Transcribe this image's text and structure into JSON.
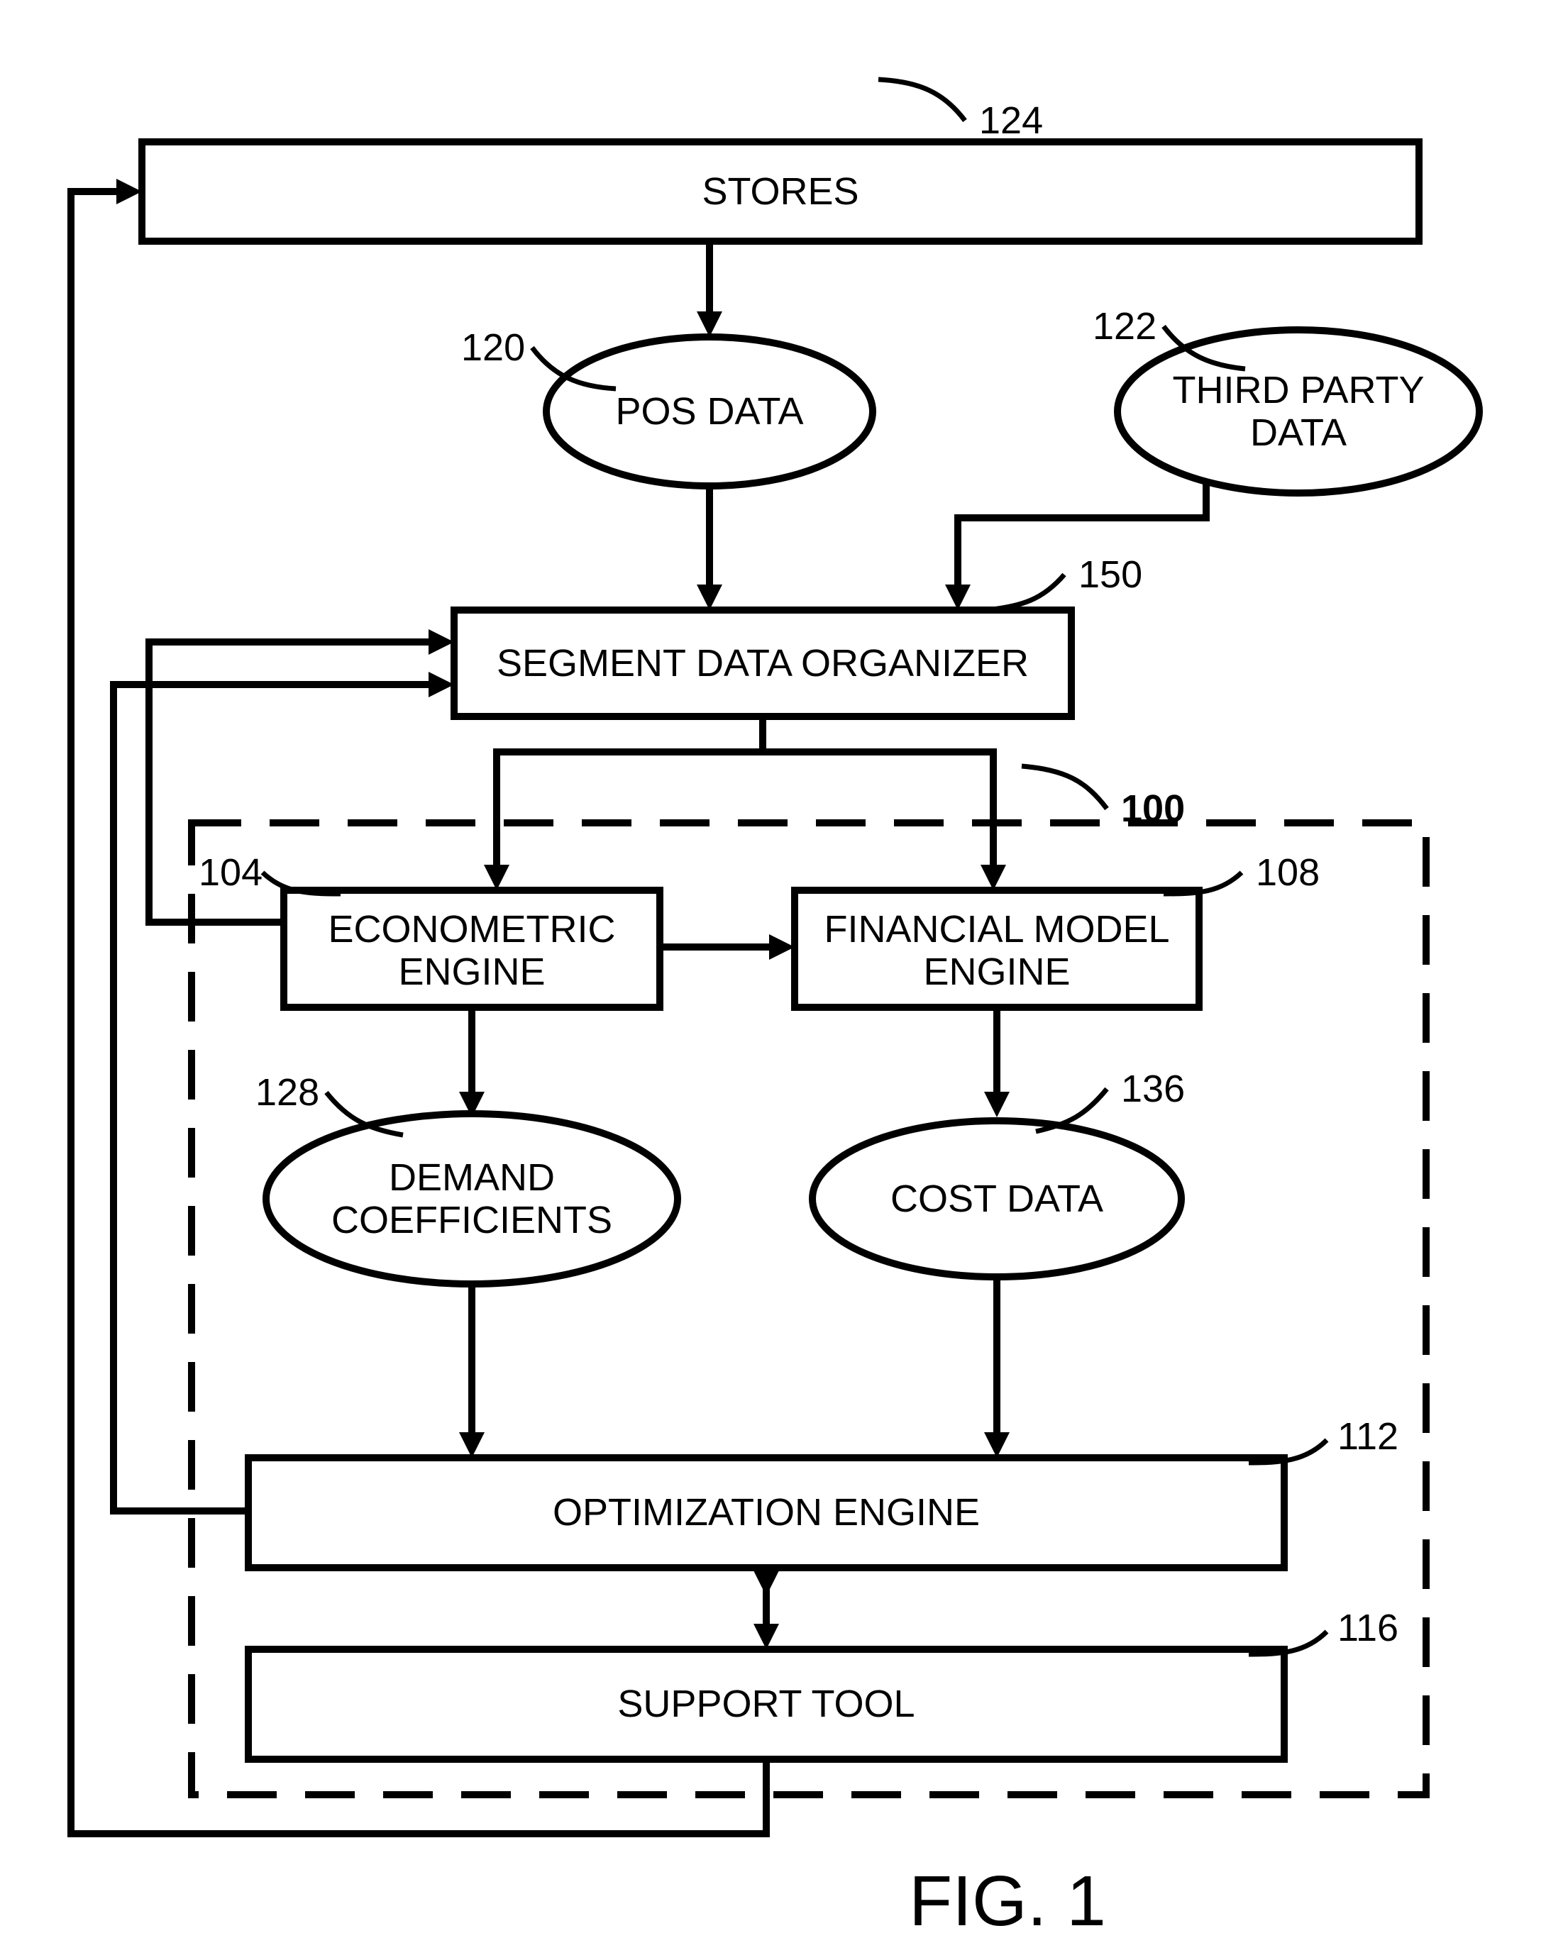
{
  "nodes": {
    "stores": {
      "label": "STORES",
      "ref": "124"
    },
    "pos_data": {
      "label": "POS DATA",
      "ref": "120"
    },
    "third_party": {
      "label1": "THIRD PARTY",
      "label2": "DATA",
      "ref": "122"
    },
    "segment_organizer": {
      "label": "SEGMENT DATA ORGANIZER",
      "ref": "150"
    },
    "group": {
      "ref": "100"
    },
    "econometric": {
      "label1": "ECONOMETRIC",
      "label2": "ENGINE",
      "ref": "104"
    },
    "financial": {
      "label1": "FINANCIAL MODEL",
      "label2": "ENGINE",
      "ref": "108"
    },
    "demand": {
      "label1": "DEMAND",
      "label2": "COEFFICIENTS",
      "ref": "128"
    },
    "cost": {
      "label": "COST DATA",
      "ref": "136"
    },
    "optimization": {
      "label": "OPTIMIZATION ENGINE",
      "ref": "112"
    },
    "support": {
      "label": "SUPPORT TOOL",
      "ref": "116"
    }
  },
  "figure_caption": "FIG. 1"
}
